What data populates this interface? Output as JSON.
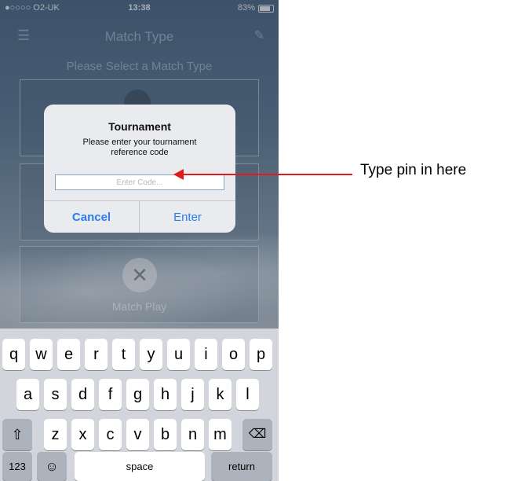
{
  "status": {
    "carrier": "●○○○○ O2-UK",
    "time": "13:38",
    "battery": "83%"
  },
  "nav": {
    "title": "Match Type"
  },
  "subtitle": "Please Select a Match Type",
  "cards": [
    {
      "label": ""
    },
    {
      "label": ""
    },
    {
      "label": "Match Play"
    }
  ],
  "alert": {
    "title": "Tournament",
    "message": "Please enter your tournament reference code",
    "input_placeholder": "Enter Code...",
    "input_value": "",
    "cancel_label": "Cancel",
    "enter_label": "Enter"
  },
  "keyboard": {
    "row1": [
      "q",
      "w",
      "e",
      "r",
      "t",
      "y",
      "u",
      "i",
      "o",
      "p"
    ],
    "row2": [
      "a",
      "s",
      "d",
      "f",
      "g",
      "h",
      "j",
      "k",
      "l"
    ],
    "row3": [
      "z",
      "x",
      "c",
      "v",
      "b",
      "n",
      "m"
    ],
    "numbers_label": "123",
    "space_label": "space",
    "return_label": "return"
  },
  "annotation": {
    "text": "Type pin in here",
    "color": "#e31a1a"
  },
  "colors": {
    "accent": "#2b7cf2"
  }
}
